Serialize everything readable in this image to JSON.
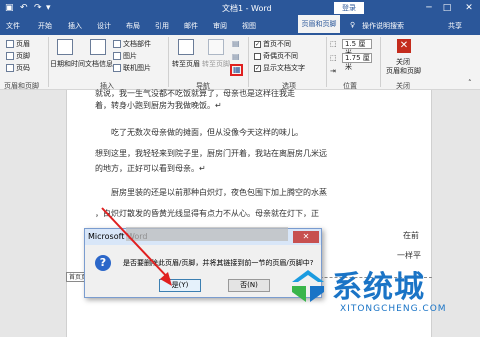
{
  "titlebar": {
    "save_icon": "save-icon",
    "undo_icon": "undo-icon",
    "redo_icon": "redo-icon",
    "doc_title": "文档1 - Word",
    "sign_in": "登录",
    "minimize": "─",
    "restore": "□",
    "close": "✕"
  },
  "tabs": {
    "file": "文件",
    "home": "开始",
    "insert": "插入",
    "design": "设计",
    "layout": "布局",
    "references": "引用",
    "mailings": "邮件",
    "review": "审阅",
    "view": "视图",
    "active_tab": "页眉和页脚",
    "tell_me": "操作说明搜索",
    "share": "共享"
  },
  "ribbon": {
    "header": "页眉",
    "footer": "页脚",
    "page_number": "页码",
    "group_header_footer": "页眉和页脚",
    "date_time": "日期和时间",
    "doc_info": "文档信息",
    "doc_parts": "文档部件",
    "picture": "图片",
    "online_picture": "联机图片",
    "group_insert": "插入",
    "goto_header": "转至页眉",
    "goto_footer": "转至页脚",
    "group_nav": "导航",
    "first_diff": "首页不同",
    "odd_even_diff": "奇偶页不同",
    "show_doc_text": "显示文档文字",
    "group_options": "选项",
    "header_pos": "1.5 厘米",
    "footer_pos": "1.75 厘米",
    "group_position": "位置",
    "close_label_1": "关闭",
    "close_label_2": "页眉和页脚",
    "group_close": "关闭"
  },
  "document": {
    "line1": "就说，我一生气没都不吃饭就算了，母亲也是这样往我走",
    "line2": "着，转身小跑到厨房为我做晚饭。↵",
    "line3": "吃了无数次母亲做的摊面，但从没像今天这样的味儿。",
    "line4": "想到这里，我轻轻来到院子里，厨房门开着，我站在离厨房几米远",
    "line5": "的地方，正好可以看到母亲。↵",
    "line6": "厨房里装的还是以前那种白炽灯，夜色包围下加上腾空的水蒸",
    "line7": "，白炽灯散发的昏黄光线显得有点力不从心。母亲就在灯下，正",
    "line8": "在前",
    "line9": "一样平",
    "header_tag": "首页页眉"
  },
  "dialog": {
    "title": "Microsoft Word",
    "close": "✕",
    "message": "是否要删除此页眉/页脚，并将其链接到前一节的页眉/页脚中?",
    "yes": "是(Y)",
    "no": "否(N)"
  },
  "watermark": {
    "text": "系统城",
    "url": "XITONGCHENG.COM"
  }
}
